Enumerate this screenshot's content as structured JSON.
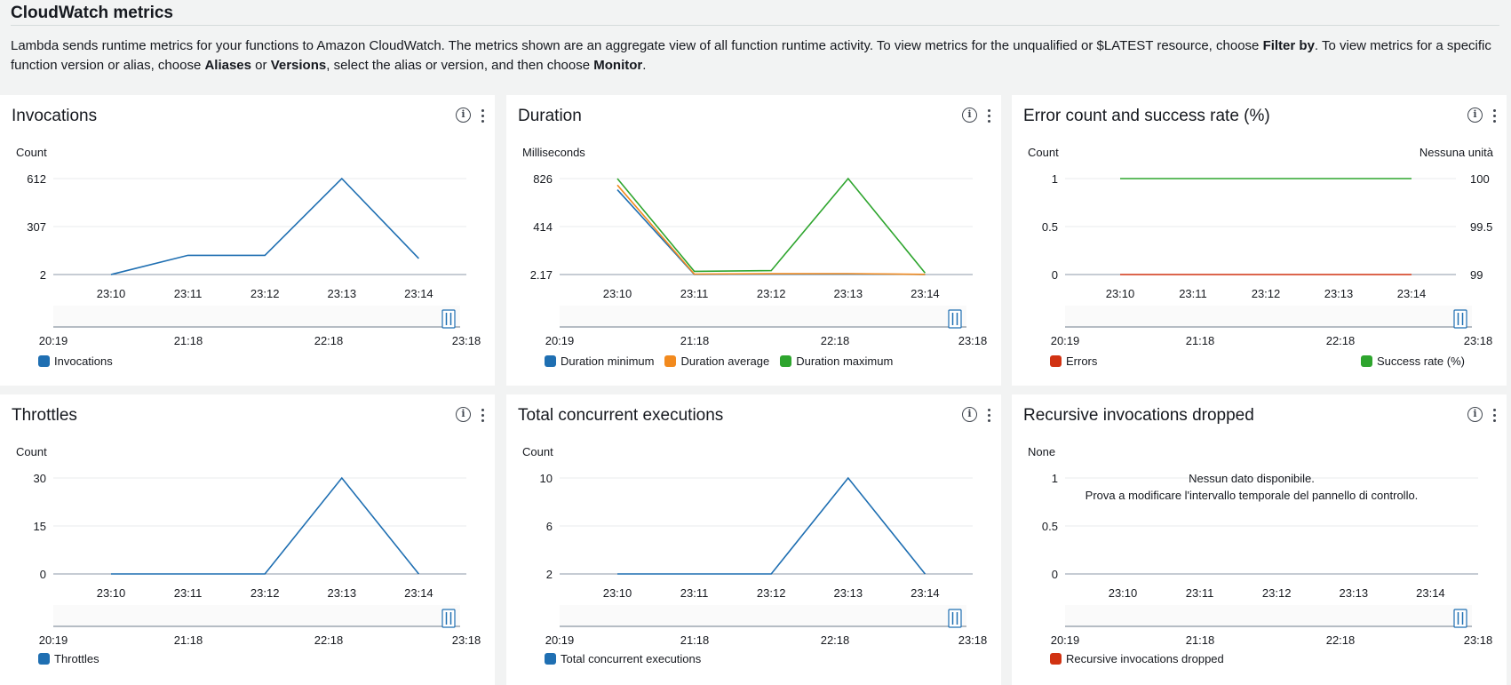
{
  "header": {
    "title": "CloudWatch metrics",
    "description": {
      "p1": "Lambda sends runtime metrics for your functions to Amazon CloudWatch. The metrics shown are an aggregate view of all function runtime activity. To view metrics for the unqualified or $LATEST resource, choose ",
      "b1": "Filter by",
      "p2": ". To view metrics for a specific function version or alias, choose ",
      "b2": "Aliases",
      "p3": " or ",
      "b3": "Versions",
      "p4": ", select the alias or version, and then choose ",
      "b4": "Monitor",
      "p5": "."
    }
  },
  "colors": {
    "blue": "#1f6fb2",
    "orange": "#f28a1e",
    "green": "#2ea52e",
    "red": "#d13212",
    "grid": "#e9ebed"
  },
  "icons": {
    "info": "info-icon",
    "more": "vertical-ellipsis-icon"
  },
  "panels": [
    {
      "title": "Invocations",
      "no_data": "",
      "chart_data": {
        "type": "line",
        "ylabel": "Count",
        "ylabel_right": "",
        "yticks": [
          "612",
          "307",
          "2"
        ],
        "ylim": [
          2,
          612
        ],
        "yticks_right": [],
        "x": [
          "23:10",
          "23:11",
          "23:12",
          "23:13",
          "23:14"
        ],
        "range_ticks": [
          "20:19",
          "21:18",
          "22:18",
          "23:18"
        ],
        "series": [
          {
            "name": "Invocations",
            "color": "#1f6fb2",
            "values": [
              2,
              124,
              124,
              612,
              104
            ]
          }
        ]
      }
    },
    {
      "title": "Duration",
      "no_data": "",
      "chart_data": {
        "type": "line",
        "ylabel": "Milliseconds",
        "ylabel_right": "",
        "yticks": [
          "826",
          "414",
          "2.17"
        ],
        "ylim": [
          2.17,
          826
        ],
        "yticks_right": [],
        "x": [
          "23:10",
          "23:11",
          "23:12",
          "23:13",
          "23:14"
        ],
        "range_ticks": [
          "20:19",
          "21:18",
          "22:18",
          "23:18"
        ],
        "series": [
          {
            "name": "Duration minimum",
            "color": "#1f6fb2",
            "values": [
              730,
              4,
              5,
              7,
              3
            ]
          },
          {
            "name": "Duration average",
            "color": "#f28a1e",
            "values": [
              770,
              6,
              9,
              10,
              4
            ]
          },
          {
            "name": "Duration maximum",
            "color": "#2ea52e",
            "values": [
              826,
              30,
              36,
              826,
              16
            ]
          }
        ]
      }
    },
    {
      "title": "Error count and success rate (%)",
      "no_data": "",
      "chart_data": {
        "type": "line",
        "ylabel": "Count",
        "ylabel_right": "Nessuna unità",
        "yticks": [
          "1",
          "0.5",
          "0"
        ],
        "ylim": [
          0,
          1
        ],
        "yticks_right": [
          "100",
          "99.5",
          "99"
        ],
        "ylim_right": [
          99,
          100
        ],
        "x": [
          "23:10",
          "23:11",
          "23:12",
          "23:13",
          "23:14"
        ],
        "range_ticks": [
          "20:19",
          "21:18",
          "22:18",
          "23:18"
        ],
        "series": [
          {
            "name": "Errors",
            "color": "#d13212",
            "axis": "left",
            "values": [
              0,
              0,
              0,
              0,
              0
            ]
          },
          {
            "name": "Success rate (%)",
            "color": "#2ea52e",
            "axis": "right",
            "values": [
              100,
              100,
              100,
              100,
              100
            ]
          }
        ]
      }
    },
    {
      "title": "Throttles",
      "no_data": "",
      "chart_data": {
        "type": "line",
        "ylabel": "Count",
        "ylabel_right": "",
        "yticks": [
          "30",
          "15",
          "0"
        ],
        "ylim": [
          0,
          30
        ],
        "yticks_right": [],
        "x": [
          "23:10",
          "23:11",
          "23:12",
          "23:13",
          "23:14"
        ],
        "range_ticks": [
          "20:19",
          "21:18",
          "22:18",
          "23:18"
        ],
        "series": [
          {
            "name": "Throttles",
            "color": "#1f6fb2",
            "values": [
              0,
              0,
              0,
              30,
              0
            ]
          }
        ]
      }
    },
    {
      "title": "Total concurrent executions",
      "no_data": "",
      "chart_data": {
        "type": "line",
        "ylabel": "Count",
        "ylabel_right": "",
        "yticks": [
          "10",
          "6",
          "2"
        ],
        "ylim": [
          2,
          10
        ],
        "yticks_right": [],
        "x": [
          "23:10",
          "23:11",
          "23:12",
          "23:13",
          "23:14"
        ],
        "range_ticks": [
          "20:19",
          "21:18",
          "22:18",
          "23:18"
        ],
        "series": [
          {
            "name": "Total concurrent executions",
            "color": "#1f6fb2",
            "values": [
              2,
              2,
              2,
              10,
              2
            ]
          }
        ]
      }
    },
    {
      "title": "Recursive invocations dropped",
      "no_data": "Nessun dato disponibile.",
      "no_data_hint": "Prova a modificare l'intervallo temporale del pannello di controllo.",
      "chart_data": {
        "type": "line",
        "ylabel": "None",
        "ylabel_right": "",
        "yticks": [
          "1",
          "0.5",
          "0"
        ],
        "ylim": [
          0,
          1
        ],
        "yticks_right": [],
        "x": [
          "23:10",
          "23:11",
          "23:12",
          "23:13",
          "23:14"
        ],
        "range_ticks": [
          "20:19",
          "21:18",
          "22:18",
          "23:18"
        ],
        "series": [
          {
            "name": "Recursive invocations dropped",
            "color": "#d13212",
            "values": []
          }
        ]
      }
    }
  ]
}
